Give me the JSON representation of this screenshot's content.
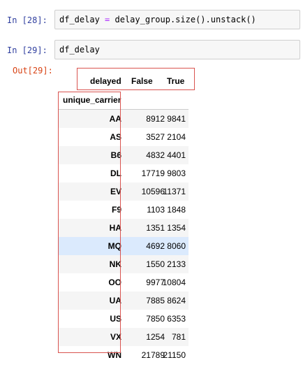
{
  "cells": [
    {
      "prompt": "In  [28]:",
      "code_prefix": "df_delay ",
      "code_op": "=",
      "code_suffix": " delay_group.size().unstack()"
    },
    {
      "prompt": "In  [29]:",
      "code": "df_delay"
    }
  ],
  "output": {
    "prompt": "Out[29]:"
  },
  "table": {
    "columns_name": "delayed",
    "columns": [
      "False",
      "True"
    ],
    "index_name": "unique_carrier",
    "rows": [
      {
        "label": "AA",
        "v": [
          "8912",
          "9841"
        ]
      },
      {
        "label": "AS",
        "v": [
          "3527",
          "2104"
        ]
      },
      {
        "label": "B6",
        "v": [
          "4832",
          "4401"
        ]
      },
      {
        "label": "DL",
        "v": [
          "17719",
          "9803"
        ]
      },
      {
        "label": "EV",
        "v": [
          "10596",
          "11371"
        ]
      },
      {
        "label": "F9",
        "v": [
          "1103",
          "1848"
        ]
      },
      {
        "label": "HA",
        "v": [
          "1351",
          "1354"
        ]
      },
      {
        "label": "MQ",
        "v": [
          "4692",
          "8060"
        ]
      },
      {
        "label": "NK",
        "v": [
          "1550",
          "2133"
        ]
      },
      {
        "label": "OO",
        "v": [
          "9977",
          "10804"
        ]
      },
      {
        "label": "UA",
        "v": [
          "7885",
          "8624"
        ]
      },
      {
        "label": "US",
        "v": [
          "7850",
          "6353"
        ]
      },
      {
        "label": "VX",
        "v": [
          "1254",
          "781"
        ]
      },
      {
        "label": "WN",
        "v": [
          "21789",
          "21150"
        ]
      }
    ]
  },
  "colors": {
    "annotation": "#d9534f",
    "highlight_row": "#dbeafd"
  }
}
